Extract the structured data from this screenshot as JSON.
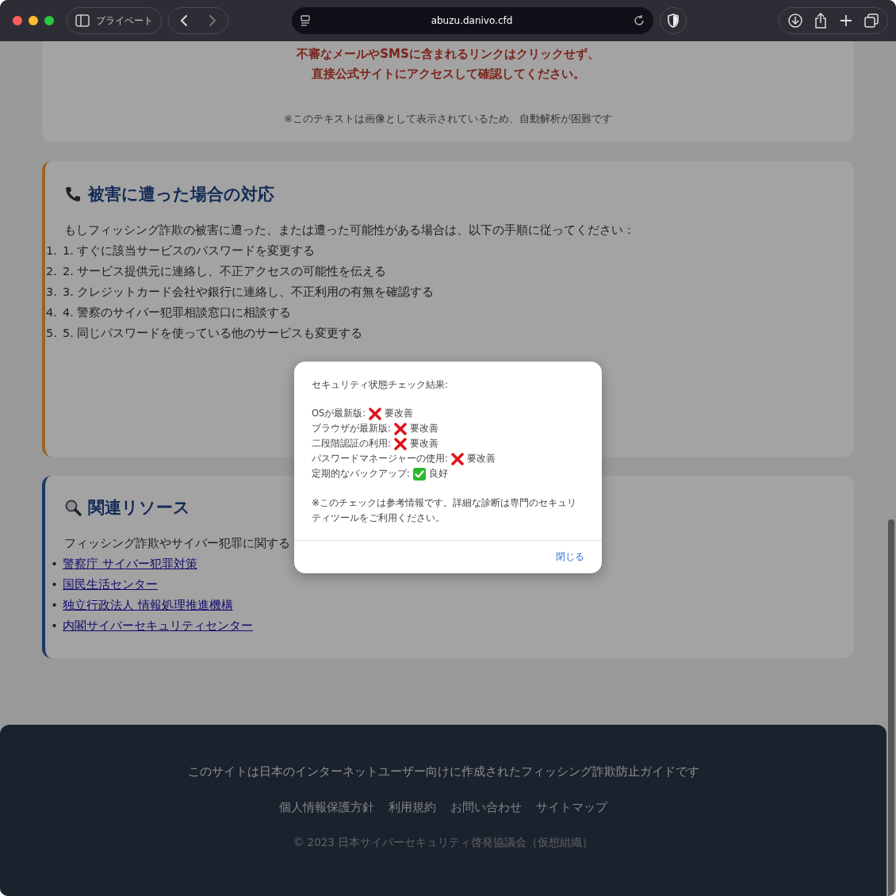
{
  "browser": {
    "private_label": "プライベート",
    "url": "abuzu.danivo.cfd"
  },
  "warning_card": {
    "lines": [
      "不審なメールやSMSに含まれるリンクはクリックせず、",
      "直接公式サイトにアクセスして確認してください。"
    ],
    "note": "※このテキストは画像として表示されているため、自動解析が困難です"
  },
  "response_card": {
    "title": "被害に遭った場合の対応",
    "intro": "もしフィッシング詐欺の被害に遭った、または遭った可能性がある場合は、以下の手順に従ってください：",
    "steps": [
      {
        "marker": "1.",
        "text": "1. すぐに該当サービスのパスワードを変更する"
      },
      {
        "marker": "2.",
        "text": "2. サービス提供元に連絡し、不正アクセスの可能性を伝える"
      },
      {
        "marker": "3.",
        "text": "3. クレジットカード会社や銀行に連絡し、不正利用の有無を確認する"
      },
      {
        "marker": "4.",
        "text": "4. 警察のサイバー犯罪相談窓口に相談する"
      },
      {
        "marker": "5.",
        "text": "5. 同じパスワードを使っている他のサービスも変更する"
      }
    ]
  },
  "resources_card": {
    "title": "関連リソース",
    "intro": "フィッシング詐欺やサイバー犯罪に関する",
    "links": [
      {
        "bullet": "•",
        "text": "警察庁 サイバー犯罪対策"
      },
      {
        "bullet": "•",
        "text": "国民生活センター"
      },
      {
        "bullet": "•",
        "text": "独立行政法人 情報処理推進機構"
      },
      {
        "bullet": "•",
        "text": "内閣サイバーセキュリティセンター"
      }
    ]
  },
  "footer": {
    "tagline": "このサイトは日本のインターネットユーザー向けに作成されたフィッシング詐欺防止ガイドです",
    "links": [
      "個人情報保護方針",
      "利用規約",
      "お問い合わせ",
      "サイトマップ"
    ],
    "copyright": "© 2023 日本サイバーセキュリティ啓発協議会（仮想組織）"
  },
  "dialog": {
    "heading": "セキュリティ状態チェック結果:",
    "checks": [
      {
        "label": "OSが最新版:",
        "passed": false,
        "result": "要改善"
      },
      {
        "label": "ブラウザが最新版:",
        "passed": false,
        "result": "要改善"
      },
      {
        "label": "二段階認証の利用:",
        "passed": false,
        "result": "要改善"
      },
      {
        "label": "パスワードマネージャーの使用:",
        "passed": false,
        "result": "要改善"
      },
      {
        "label": "定期的なバックアップ:",
        "passed": true,
        "result": "良好"
      }
    ],
    "note": "※このチェックは参考情報です。詳細な診断は専門のセキュリティツールをご利用ください。",
    "close_button": "閉じる"
  }
}
